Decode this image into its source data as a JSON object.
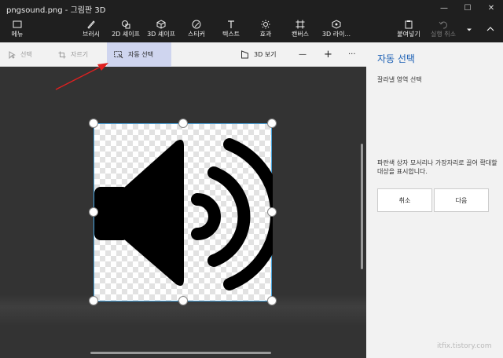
{
  "window": {
    "title": "pngsound.png - 그림판 3D",
    "minimize_glyph": "—",
    "maximize_glyph": "☐",
    "close_glyph": "✕"
  },
  "ribbon": {
    "menu_label": "메뉴",
    "items": [
      {
        "label": "브러시",
        "icon": "brush-icon"
      },
      {
        "label": "2D 셰이프",
        "icon": "shapes-2d-icon"
      },
      {
        "label": "3D 셰이프",
        "icon": "cube-icon"
      },
      {
        "label": "스티커",
        "icon": "sticker-icon"
      },
      {
        "label": "텍스트",
        "icon": "text-icon"
      },
      {
        "label": "효과",
        "icon": "sun-icon"
      },
      {
        "label": "캔버스",
        "icon": "canvas-icon"
      },
      {
        "label": "3D 라이...",
        "icon": "library-icon"
      }
    ],
    "paste_label": "붙여넣기",
    "undo_label": "실행 취소"
  },
  "subbar": {
    "select_label": "선택",
    "crop_label": "자르기",
    "auto_select_label": "자동 선택",
    "view3d_label": "3D 보기",
    "zoom_out_glyph": "—",
    "zoom_in_glyph": "+",
    "more_glyph": "···"
  },
  "panel": {
    "title": "자동 선택",
    "subtitle": "잘라낼 영역 선택",
    "description": "파란색 상자 모서리나 가장자리로 끌어 확대할 대상을 표시합니다.",
    "cancel_label": "취소",
    "next_label": "다음"
  },
  "watermark": "itfix.tistory.com",
  "colors": {
    "accent": "#1a5fb4",
    "selection_border": "#4aa6e0",
    "active_tool_bg": "#cfd5ef",
    "arrow": "#e02020"
  }
}
